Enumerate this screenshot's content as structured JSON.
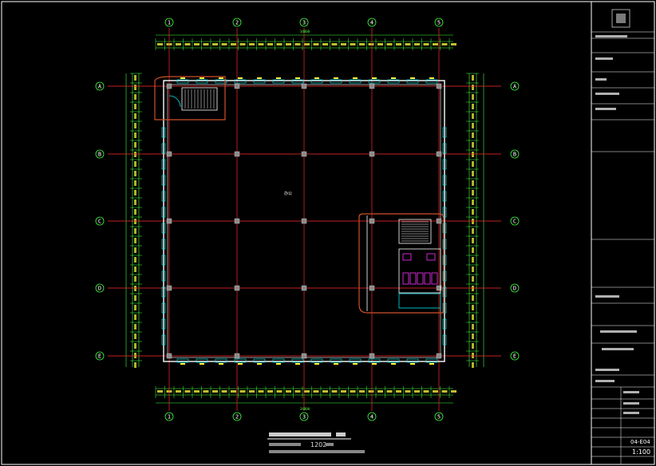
{
  "drawing": {
    "axis_columns": [
      "1",
      "2",
      "3",
      "4",
      "5"
    ],
    "axis_rows": [
      "A",
      "B",
      "C",
      "D",
      "E"
    ],
    "overall_dimension_label": "34800",
    "scale_note_label": "1202",
    "center_room_label": "办公",
    "colors": {
      "background": "#000000",
      "axis_line": "#ff2a2a",
      "wall": "#ffffff",
      "window": "#00e5e5",
      "dimension": "#40ff40",
      "stair_ring": "#d0502a",
      "fixture": "#ff33ff",
      "annotation": "#ffff40",
      "column": "#8a8a8a"
    }
  },
  "title_block": {
    "scale": "1:100",
    "drawing_number": "04-E04"
  }
}
